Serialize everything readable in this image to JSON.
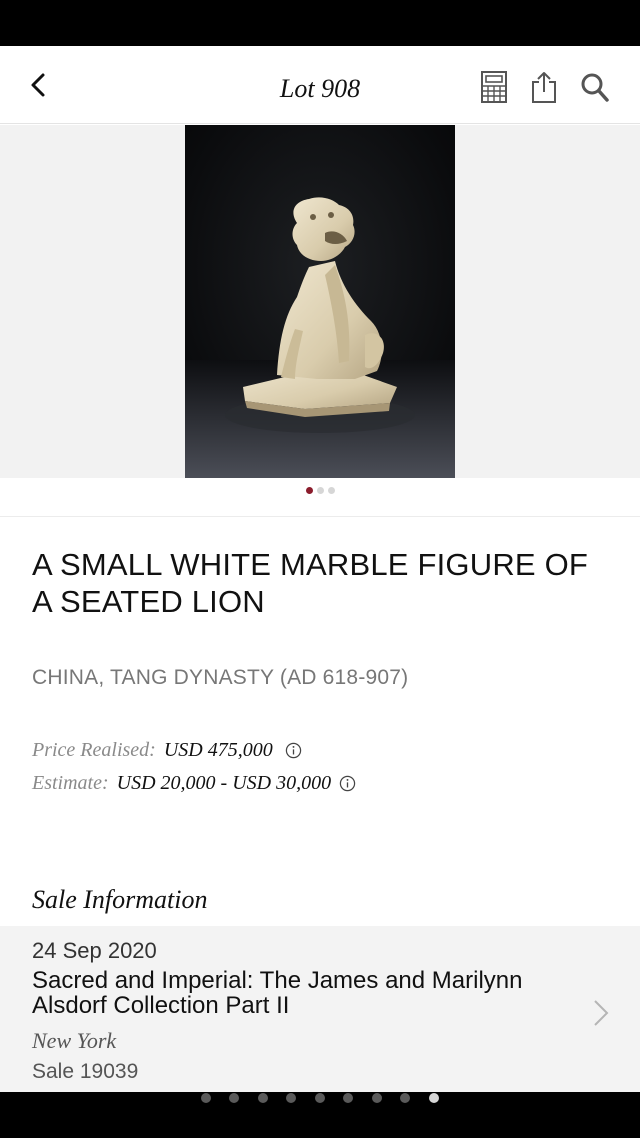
{
  "nav": {
    "title": "Lot 908",
    "back_icon": "chevron-left-icon",
    "icons": [
      "calculator-icon",
      "share-icon",
      "search-icon"
    ]
  },
  "gallery": {
    "image_alt": "A small white marble figure of a seated lion",
    "image_count": 3,
    "current_index": 0
  },
  "lot": {
    "title": "A SMALL WHITE MARBLE FIGURE OF A SEATED LION",
    "subtitle": "CHINA, TANG DYNASTY (AD 618-907)",
    "price_realised_label": "Price Realised:",
    "price_realised_value": "USD 475,000",
    "estimate_label": "Estimate:",
    "estimate_value": "USD 20,000 - USD 30,000"
  },
  "sale": {
    "heading": "Sale Information",
    "date": "24 Sep 2020",
    "name": "Sacred and Imperial: The James and Marilynn Alsdorf Collection Part II",
    "location": "New York",
    "number": "Sale 19039"
  },
  "pager": {
    "count": 9,
    "active_index": 8
  },
  "colors": {
    "accent": "#8b1c2c",
    "muted_text": "#777777",
    "card_background": "#f3f3f3"
  }
}
